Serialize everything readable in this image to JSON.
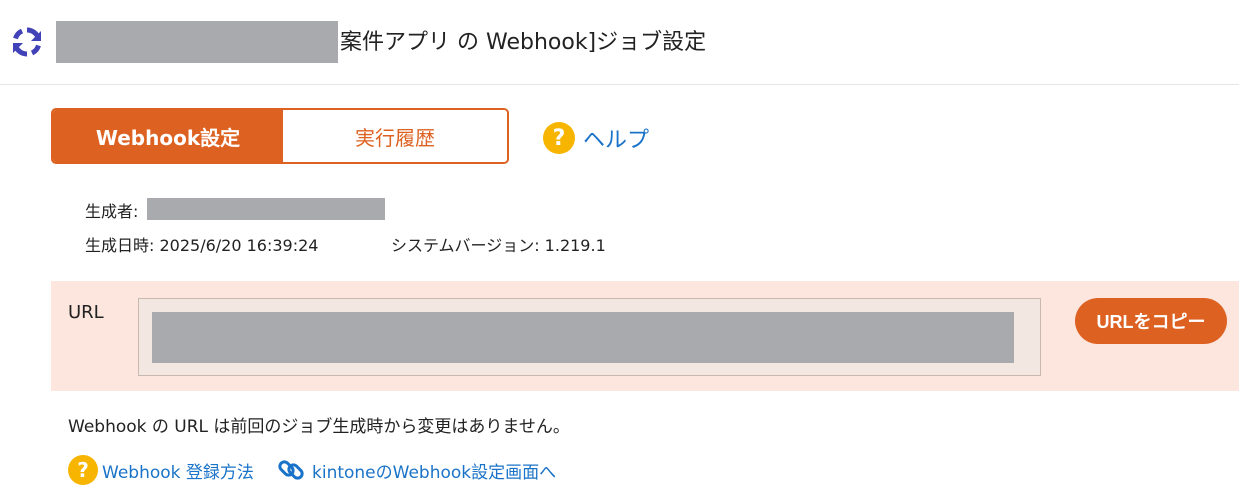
{
  "header": {
    "refresh_icon": "sync-icon",
    "title_suffix": "案件アプリ の Webhook]ジョブ設定"
  },
  "tabs": [
    {
      "label": "Webhook設定",
      "active": true
    },
    {
      "label": "実行履歴",
      "active": false
    }
  ],
  "help": {
    "icon": "help-circle-icon",
    "label": "ヘルプ"
  },
  "meta": {
    "creator_label": "生成者:",
    "generated_at": "生成日時: 2025/6/20 16:39:24",
    "system_version": "システムバージョン: 1.219.1"
  },
  "url_section": {
    "label": "URL",
    "copy_button": "URLをコピー"
  },
  "notice": "Webhook の URL は前回のジョブ生成時から変更はありません。",
  "links": [
    {
      "icon": "help-circle-icon",
      "label": "Webhook 登録方法"
    },
    {
      "icon": "link-chain-icon",
      "label": "kintoneのWebhook設定画面へ"
    }
  ],
  "colors": {
    "accent": "#dd6222",
    "link": "#1a73c8",
    "help_badge": "#f7b500",
    "url_panel_bg": "#fde6de",
    "redaction": "#a9aaad",
    "sync_icon": "#4142b8"
  }
}
